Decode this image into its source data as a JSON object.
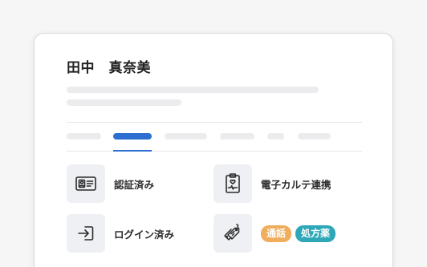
{
  "patient": {
    "name": "田中　真奈美"
  },
  "features": [
    {
      "label": "認証済み",
      "icon": "id-card-icon"
    },
    {
      "label": "電子カルテ連携",
      "icon": "medical-clipboard-icon"
    },
    {
      "label": "ログイン済み",
      "icon": "login-icon"
    },
    {
      "icon": "tags-icon"
    }
  ],
  "badges": [
    {
      "label": "通話",
      "color": "#f0ad5c"
    },
    {
      "label": "処方薬",
      "color": "#2ea7b8"
    }
  ],
  "colors": {
    "accent": "#2c6fd1",
    "icon_bg": "#eef0f3",
    "skeleton": "#ececef"
  }
}
